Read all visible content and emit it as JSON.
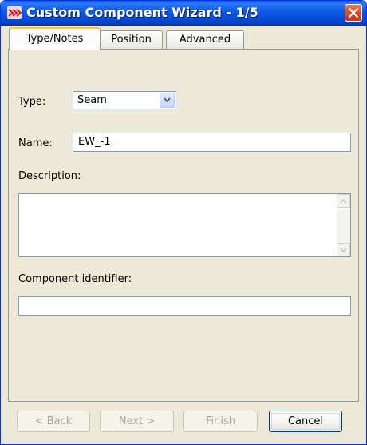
{
  "window": {
    "title": "Custom Component Wizard - 1/5"
  },
  "icons": {
    "app": "custom-component-app-icon",
    "close": "close-icon",
    "dropdown": "chevron-down-icon",
    "scroll_up": "scroll-up-arrow-icon",
    "scroll_down": "scroll-down-arrow-icon"
  },
  "colors": {
    "titlebar": "#0d5ae7",
    "window_bg": "#ece9d8",
    "close_button": "#d94d27",
    "active_tab_accent": "#ffc83c"
  },
  "tabs": [
    {
      "label": "Type/Notes",
      "active": true
    },
    {
      "label": "Position",
      "active": false
    },
    {
      "label": "Advanced",
      "active": false
    }
  ],
  "form": {
    "type_label": "Type:",
    "type_value": "Seam",
    "name_label": "Name:",
    "name_value": "EW_-1",
    "description_label": "Description:",
    "description_value": "",
    "identifier_label": "Component identifier:",
    "identifier_value": ""
  },
  "buttons": {
    "back": {
      "label": "< Back",
      "enabled": false
    },
    "next": {
      "label": "Next >",
      "enabled": false
    },
    "finish": {
      "label": "Finish",
      "enabled": false
    },
    "cancel": {
      "label": "Cancel",
      "enabled": true
    }
  }
}
